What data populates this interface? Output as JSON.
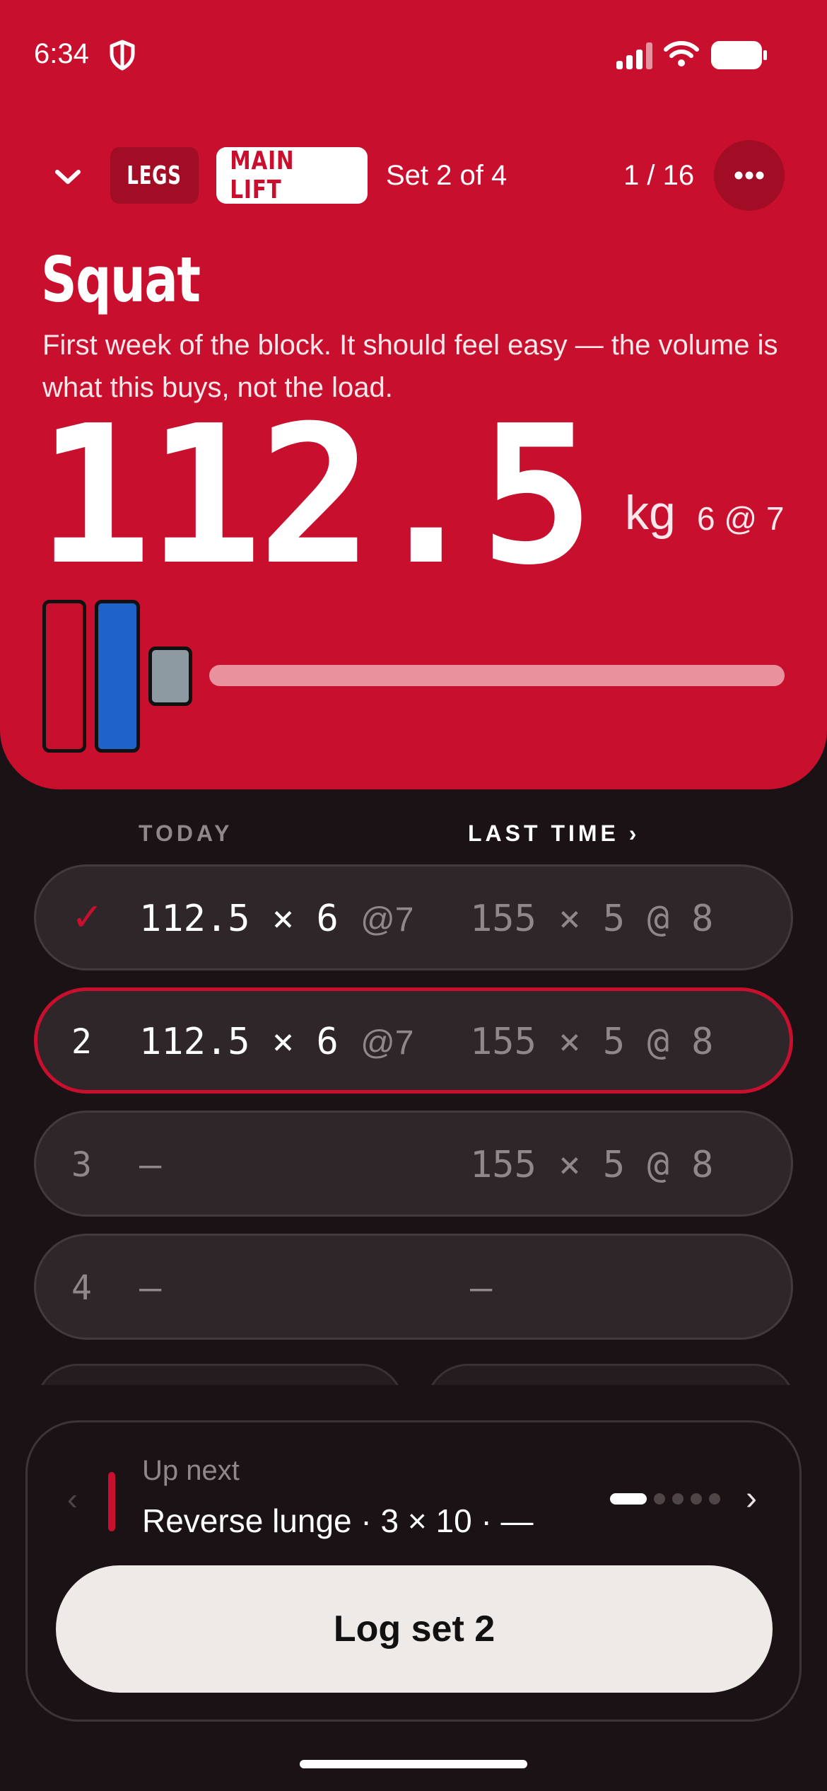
{
  "status_bar": {
    "time": "6:34"
  },
  "header": {
    "tag_muscle": "LEGS",
    "tag_type": "MAIN LIFT",
    "set_progress": "Set 2 of 4",
    "counter": "1 / 16"
  },
  "exercise": {
    "name": "Squat",
    "note": "First week of the block. It should feel easy — the volume is what this buys, not the load.",
    "weight": "112.5",
    "unit": "kg",
    "target": "6 @ 7"
  },
  "plates": {
    "colors": {
      "red": "#c8102e",
      "blue": "#1e64c8",
      "grey": "#8e9aa2"
    }
  },
  "columns": {
    "today": "TODAY",
    "last_time": "LAST TIME ›"
  },
  "sets": [
    {
      "num": "✓",
      "today": "112.5 × 6",
      "rpe": "@7",
      "last": "155 × 5 @ 8",
      "state": "done"
    },
    {
      "num": "2",
      "today": "112.5 × 6",
      "rpe": "@7",
      "last": "155 × 5 @ 8",
      "state": "active"
    },
    {
      "num": "3",
      "today": "—",
      "rpe": "",
      "last": "155 × 5 @ 8",
      "state": "pending"
    },
    {
      "num": "4",
      "today": "—",
      "rpe": "",
      "last": "—",
      "state": "pending"
    }
  ],
  "up_next": {
    "label": "Up next",
    "text": "Reverse lunge · 3 × 10 · —",
    "pager_total": 5,
    "pager_active": 1
  },
  "log_button": "Log set 2",
  "colors": {
    "accent": "#c8102e",
    "background": "#1a1214"
  }
}
